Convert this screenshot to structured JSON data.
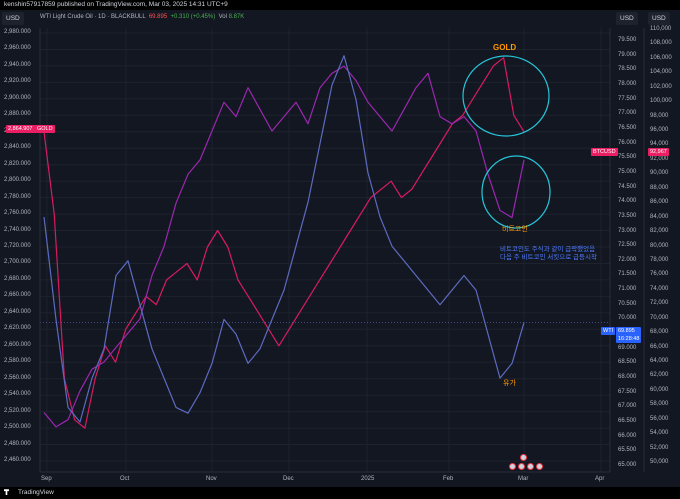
{
  "header": {
    "published": "kenshin57917859 published on TradingView.com, Mar 03, 2025 14:31 UTC+9",
    "symbol_legend": "WTI Light Crude Oil · 1D · BLACKBULL",
    "last_value": "69.895",
    "change": "+0.310 (+0.45%)",
    "vol_label": "Vol",
    "vol_value": "8.87K",
    "left_currency": "USD",
    "right_currency_1": "USD",
    "right_currency_2": "USD"
  },
  "axes": {
    "left_ticks": [
      "2,980.000",
      "2,960.000",
      "2,940.000",
      "2,920.000",
      "2,900.000",
      "2,880.000",
      "2,860.000",
      "2,840.000",
      "2,820.000",
      "2,800.000",
      "2,780.000",
      "2,760.000",
      "2,740.000",
      "2,720.000",
      "2,700.000",
      "2,680.000",
      "2,660.000",
      "2,640.000",
      "2,620.000",
      "2,600.000",
      "2,580.000",
      "2,560.000",
      "2,540.000",
      "2,520.000",
      "2,500.000",
      "2,480.000",
      "2,460.000"
    ],
    "right1_ticks": [
      "79.500",
      "79.000",
      "78.500",
      "78.000",
      "77.500",
      "77.000",
      "76.500",
      "76.000",
      "75.500",
      "75.000",
      "74.500",
      "74.000",
      "73.500",
      "73.000",
      "72.500",
      "72.000",
      "71.500",
      "71.000",
      "70.500",
      "70.000",
      "69.500",
      "69.000",
      "68.500",
      "68.000",
      "67.500",
      "67.000",
      "66.500",
      "66.000",
      "65.500",
      "65.000"
    ],
    "right2_ticks": [
      "110,000",
      "108,000",
      "106,000",
      "104,000",
      "102,000",
      "100,000",
      "98,000",
      "96,000",
      "94,000",
      "92,000",
      "90,000",
      "88,000",
      "86,000",
      "84,000",
      "82,000",
      "80,000",
      "78,000",
      "76,000",
      "74,000",
      "72,000",
      "70,000",
      "68,000",
      "66,000",
      "64,000",
      "62,000",
      "60,000",
      "58,000",
      "56,000",
      "54,000",
      "52,000",
      "50,000"
    ],
    "x_ticks": [
      "Sep",
      "Oct",
      "Nov",
      "Dec",
      "2025",
      "Feb",
      "Mar",
      "Apr"
    ]
  },
  "badges": {
    "gold_value": "2,864.907",
    "gold_label": "GOLD",
    "btc_label": "BTCUSD",
    "btc_value": "92,967",
    "wti_label": "WTI",
    "wti_value": "69.895",
    "wti_countdown": "16:28:48"
  },
  "annotations": {
    "gold": "GOLD",
    "bitcoin": "비트코인",
    "note_line1": "비트코인도 주식과 같이 급락했었음",
    "note_line2": "다음 주 비트코인 서킷으로 급등시작",
    "oil": "유가"
  },
  "footer": {
    "brand": "TradingView"
  },
  "colors": {
    "background": "#131722",
    "gold_line": "#d81b60",
    "btc_line": "#9c27b0",
    "wti_line": "#5c6bc0",
    "circle": "#26c6da",
    "annotation_orange": "#ff9800",
    "annotation_blue": "#4f7cff"
  },
  "chart_data": {
    "type": "line",
    "x": [
      "Sep",
      "Oct",
      "Nov",
      "Dec",
      "2025",
      "Feb",
      "Mar",
      "Apr"
    ],
    "series": [
      {
        "name": "GOLD",
        "axis": "left",
        "values": [
          2860,
          2760,
          2560,
          2510,
          2500,
          2560,
          2600,
          2580,
          2620,
          2640,
          2660,
          2650,
          2680,
          2690,
          2700,
          2680,
          2720,
          2740,
          2720,
          2680,
          2660,
          2640,
          2620,
          2600,
          2620,
          2640,
          2660,
          2680,
          2700,
          2720,
          2740,
          2760,
          2780,
          2790,
          2800,
          2780,
          2790,
          2810,
          2830,
          2850,
          2870,
          2880,
          2900,
          2920,
          2940,
          2950,
          2880,
          2860
        ]
      },
      {
        "name": "BTCUSD",
        "axis": "right2",
        "values": [
          57000,
          55000,
          56000,
          60000,
          63000,
          64000,
          66000,
          68000,
          70000,
          76000,
          80000,
          86000,
          90000,
          92000,
          96000,
          100000,
          98000,
          102000,
          99000,
          96000,
          98000,
          100000,
          97000,
          102000,
          104000,
          105000,
          103000,
          100000,
          98000,
          96000,
          99000,
          102000,
          104000,
          98000,
          97000,
          98000,
          96000,
          90000,
          85000,
          84000,
          92000
        ]
      },
      {
        "name": "WTI",
        "axis": "right1",
        "values": [
          73.5,
          70.0,
          67.0,
          66.5,
          68.0,
          69.0,
          71.5,
          72.0,
          70.5,
          69.0,
          68.0,
          67.0,
          66.8,
          67.5,
          68.5,
          70.0,
          69.5,
          68.5,
          69.0,
          70.0,
          71.0,
          72.5,
          74.0,
          76.0,
          78.0,
          79.0,
          77.5,
          75.0,
          73.5,
          72.5,
          72.0,
          71.5,
          71.0,
          70.5,
          71.0,
          71.5,
          71.0,
          69.5,
          68.0,
          68.5,
          69.9
        ]
      }
    ]
  }
}
